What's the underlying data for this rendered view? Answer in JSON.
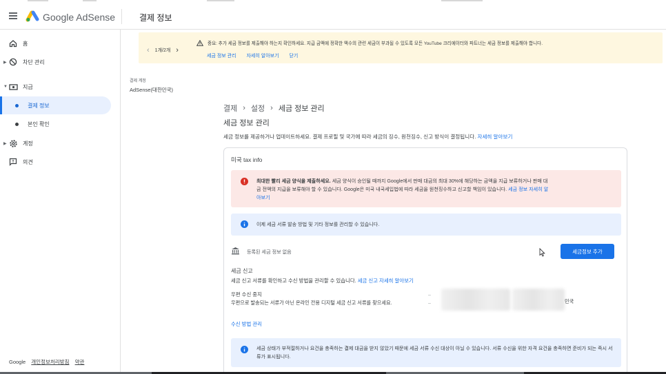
{
  "app": {
    "brand": "Google AdSense",
    "header_title": "결제 정보"
  },
  "sidebar": {
    "items": [
      {
        "label": "홈",
        "icon": "home-icon"
      },
      {
        "label": "차단 관리",
        "icon": "block-icon"
      },
      {
        "label": "지급",
        "icon": "payments-icon"
      },
      {
        "label": "결제 정보",
        "active": true
      },
      {
        "label": "본인 확인"
      },
      {
        "label": "계정",
        "icon": "gear-icon"
      },
      {
        "label": "의견",
        "icon": "feedback-icon"
      }
    ],
    "footer": {
      "google": "Google",
      "privacy": "개인정보처리방침",
      "terms": "약관"
    }
  },
  "banner": {
    "pager": "1개/2개",
    "message": "중요: 추가 세금 정보를 제출해야 하는지 확인하세요. 지급 금액에 정확한 액수의 관련 세금이 부과될 수 있도록 모든 YouTube 크리에이터와 파트너는 세금 정보를 제출해야 합니다.",
    "links": [
      "세금 정보 관리",
      "자세히 알아보기",
      "닫기"
    ]
  },
  "account": {
    "label": "결제 계정",
    "value": "AdSense(대한민국)"
  },
  "breadcrumb": [
    "결제",
    "설정",
    "세금 정보 관리"
  ],
  "page": {
    "title": "세금 정보 관리",
    "description": "세금 정보를 제공하거나 업데이트하세요. 결제 프로필 및 국가에 따라 세금의 징수, 원천징수, 신고 방식이 결정됩니다.",
    "description_link": "자세히 알아보기"
  },
  "card": {
    "title": "미국 tax info",
    "alert_red": {
      "bold": "최대한 빨리 세금 양식을 제출하세요.",
      "text_line1": " 세금 양식이 승인될 때까지 Google에서 판매 대금의 최대 30%에 해당하는 금액을 지급 보류하거나 판매 대",
      "text_line2": "금 전액의 지급을 보류해야 할 수 있습니다. Google은 미국 내국세입법에 따라 세금을 원천징수하고 신고할 책임이 있습니다. ",
      "link1": "세금 정보 자세히 알",
      "link2": "아보기"
    },
    "alert_blue": "이제 세금 서류 발송 방법 및 기타 정보를 관리할 수 있습니다.",
    "registered": "등록된 세금 정보 없음",
    "add_button": "세금정보 추가",
    "tax_report": {
      "title": "세금 신고",
      "desc": "세금 신고 서류를 확인하고 수신 방법을 관리할 수 있습니다. ",
      "link": "세금 신고 자세히 알아보기"
    },
    "mail": {
      "title": "우편 수신 중지",
      "desc": "우편으로 발송되는 서류가 아닌 온라인 전용 디지털 세금 신고 서류를 찾으세요.",
      "trail": "민국",
      "link": "수신 방법 관리"
    },
    "alert_blue2": "세금 상태가 부적절하거나 요건을 충족하는 결제 대금을 받지 않았기 때문에 세금 서류 수신 대상이 아닐 수 있습니다. 서류 수신을 위한 자격 요건을 충족하면 준비가 되는 즉시 서류가 표시됩니다."
  },
  "colors": {
    "accent": "#1a73e8",
    "banner_bg": "#fef7e0",
    "alert_red_bg": "#fce8e6",
    "alert_red_icon": "#d93025",
    "alert_blue_bg": "#e8f0fe"
  }
}
